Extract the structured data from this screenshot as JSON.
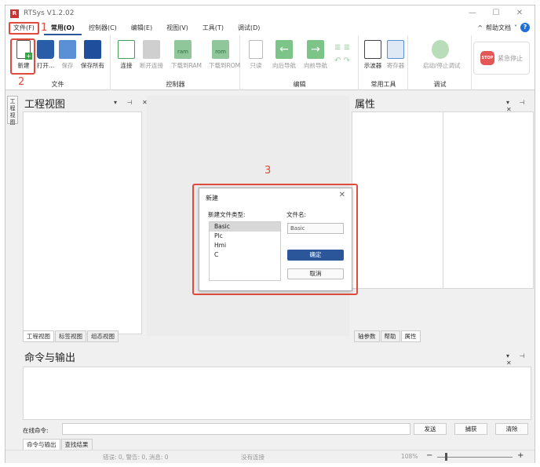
{
  "window": {
    "title": "RTSys V1.2.02",
    "min": "—",
    "max": "☐",
    "close": "✕"
  },
  "menu": {
    "items": [
      "文件(F)",
      "常用(O)",
      "控制器(C)",
      "编辑(E)",
      "视图(V)",
      "工具(T)",
      "调试(D)"
    ],
    "help_label": "帮助文档",
    "help_q": "?",
    "collapse": "^",
    "chevron": "˅"
  },
  "annotations": {
    "step1": "1",
    "step2": "2",
    "step3": "3"
  },
  "ribbon": {
    "file_group": {
      "label": "文件",
      "tools": [
        "新建",
        "打开...",
        "保存",
        "保存所有"
      ]
    },
    "controller_group": {
      "label": "控制器",
      "tools": [
        "连接",
        "断开连接",
        "下载到RAM",
        "下载到ROM"
      ],
      "ram_text": "ram",
      "rom_text": "rom"
    },
    "edit_group": {
      "label": "编辑",
      "tools": [
        "只读",
        "向后导航",
        "向前导航"
      ]
    },
    "common_tools": {
      "label": "常用工具",
      "tools": [
        "示波器",
        "寄存器"
      ]
    },
    "debug_group": {
      "label": "调试",
      "tools": [
        "启动/停止调试"
      ]
    },
    "stop": {
      "icon_text": "STOP",
      "label": "紧急停止"
    }
  },
  "panels": {
    "side_tab": "工程视图",
    "project_title": "工程视图",
    "properties_title": "属性",
    "ctrls": "▾ ⊣ ✕",
    "left_tabs": [
      "工程视图",
      "标签视图",
      "组态视图"
    ],
    "right_tabs": [
      "轴参数",
      "帮助",
      "属性"
    ]
  },
  "dialog": {
    "title": "新建",
    "close": "✕",
    "type_label": "新建文件类型:",
    "name_label": "文件名:",
    "types": [
      "Basic",
      "Plc",
      "Hmi",
      "C"
    ],
    "filename": "Basic",
    "ok": "确定",
    "cancel": "取消"
  },
  "command": {
    "title": "命令与输出",
    "input_label": "在线命令:",
    "send": "发送",
    "capture": "捕获",
    "clear": "清除",
    "tabs": [
      "命令与输出",
      "查找结果"
    ]
  },
  "status": {
    "counts": "错误: 0, 警告: 0, 消息: 0",
    "connection": "没有连接",
    "zoom": "108%",
    "minus": "−",
    "plus": "+"
  }
}
